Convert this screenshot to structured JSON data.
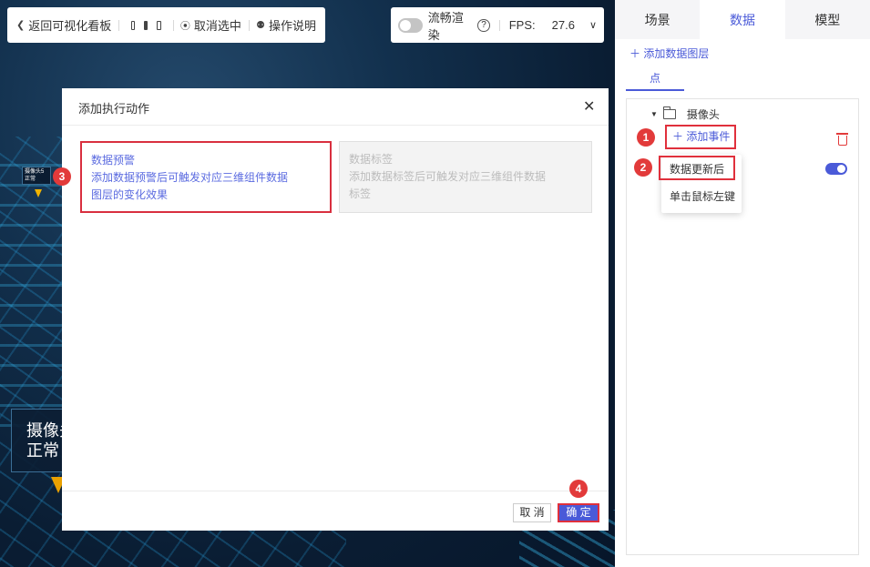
{
  "toolbar": {
    "back_label": "返回可视化看板",
    "deselect_label": "取消选中",
    "help_label": "操作说明"
  },
  "fps_panel": {
    "smooth_label": "流畅渲染",
    "help_glyph": "?",
    "fps_label": "FPS:",
    "fps_value": "27.6"
  },
  "scene": {
    "small_tag_line1": "摄像头5",
    "small_tag_line2": "正常",
    "big_tag_line1": "摄像头",
    "big_tag_line2": "正常"
  },
  "right_panel": {
    "tabs": [
      {
        "label": "场景",
        "active": false
      },
      {
        "label": "数据",
        "active": true
      },
      {
        "label": "模型",
        "active": false
      }
    ],
    "add_layer_label": "添加数据图层",
    "sub_tab_label": "点",
    "folder_label": "摄像头",
    "add_event_label": "添加事件",
    "dropdown_items": [
      "数据更新后",
      "单击鼠标左键"
    ]
  },
  "modal": {
    "title": "添加执行动作",
    "cards": [
      {
        "title": "数据预警",
        "desc_line1": "添加数据预警后可触发对应三维组件数据",
        "desc_line2": "图层的变化效果",
        "enabled": true
      },
      {
        "title": "数据标签",
        "desc_line1": "添加数据标签后可触发对应三维组件数据",
        "desc_line2": "标签",
        "enabled": false
      }
    ],
    "cancel_label": "取 消",
    "ok_label": "确 定"
  },
  "markers": [
    "1",
    "2",
    "3",
    "4"
  ],
  "colors": {
    "accent": "#4a5ad8",
    "highlight_red": "#e0303c"
  }
}
